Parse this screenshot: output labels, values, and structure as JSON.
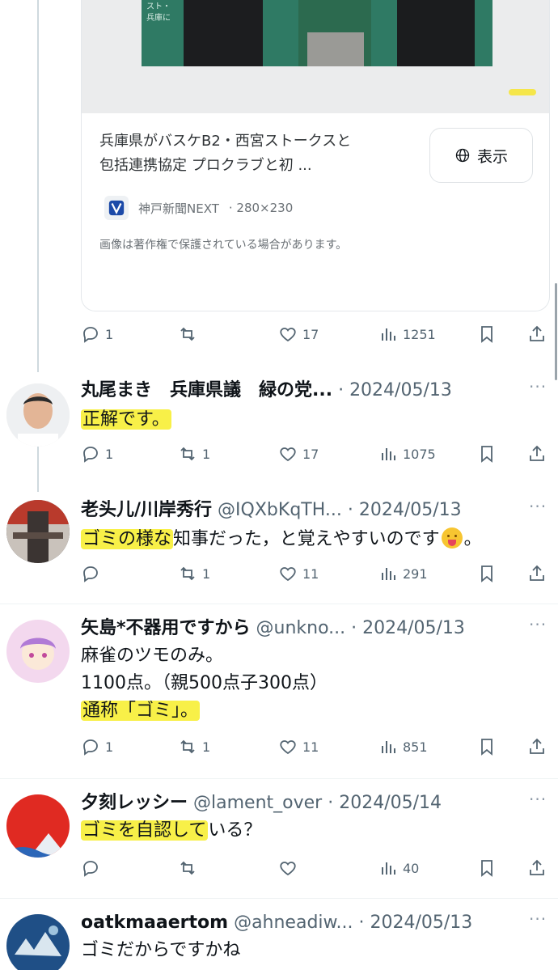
{
  "card": {
    "title_line1": "兵庫県がバスケB2・西宮ストークスと",
    "title_line2": "包括連携協定 プロクラブと初 ...",
    "view_label": "表示",
    "source_name": "神戸新聞NEXT",
    "source_size": "· 280×230",
    "copyright": "画像は著作権で保護されている場合があります。",
    "photo_text": "スト・\n兵庫に"
  },
  "card_actions": {
    "replies": "1",
    "retweets": "",
    "likes": "17",
    "views": "1251"
  },
  "tweets": [
    {
      "name": "丸尾まき　兵庫県議　緑の党...",
      "handle": "",
      "date": "· 2024/05/13",
      "text_hl": "正解です。",
      "text_rest": "",
      "replies": "1",
      "retweets": "1",
      "likes": "17",
      "views": "1075"
    },
    {
      "name": "老头儿/川岸秀行",
      "handle": "@IQXbKqTH...",
      "date": "· 2024/05/13",
      "text_hl": "ゴミの様な",
      "text_rest": "知事だった，と覚えやすいのです",
      "text_end": "。",
      "replies": "",
      "retweets": "1",
      "likes": "11",
      "views": "291"
    },
    {
      "name": "矢島*不器用ですから",
      "handle": "@unkno...",
      "date": "· 2024/05/13",
      "line1": "麻雀のツモのみ。",
      "line2": "1100点。（親500点子300点）",
      "text_hl": "通称「ゴミ」。",
      "replies": "1",
      "retweets": "1",
      "likes": "11",
      "views": "851"
    },
    {
      "name": "夕刻レッシー",
      "handle": "@lament_over",
      "date": "· 2024/05/14",
      "text_hl": "ゴミを自認して",
      "text_rest": "いる？",
      "replies": "",
      "retweets": "",
      "likes": "",
      "views": "40"
    },
    {
      "name": "oatkmaaertom",
      "handle": "@ahneadiw...",
      "date": "· 2024/05/13",
      "text_rest": "ゴミだからですかね"
    }
  ],
  "more_label": "···",
  "colors": {
    "highlight": "#f8f048",
    "muted": "#536471",
    "text": "#0f1419"
  }
}
